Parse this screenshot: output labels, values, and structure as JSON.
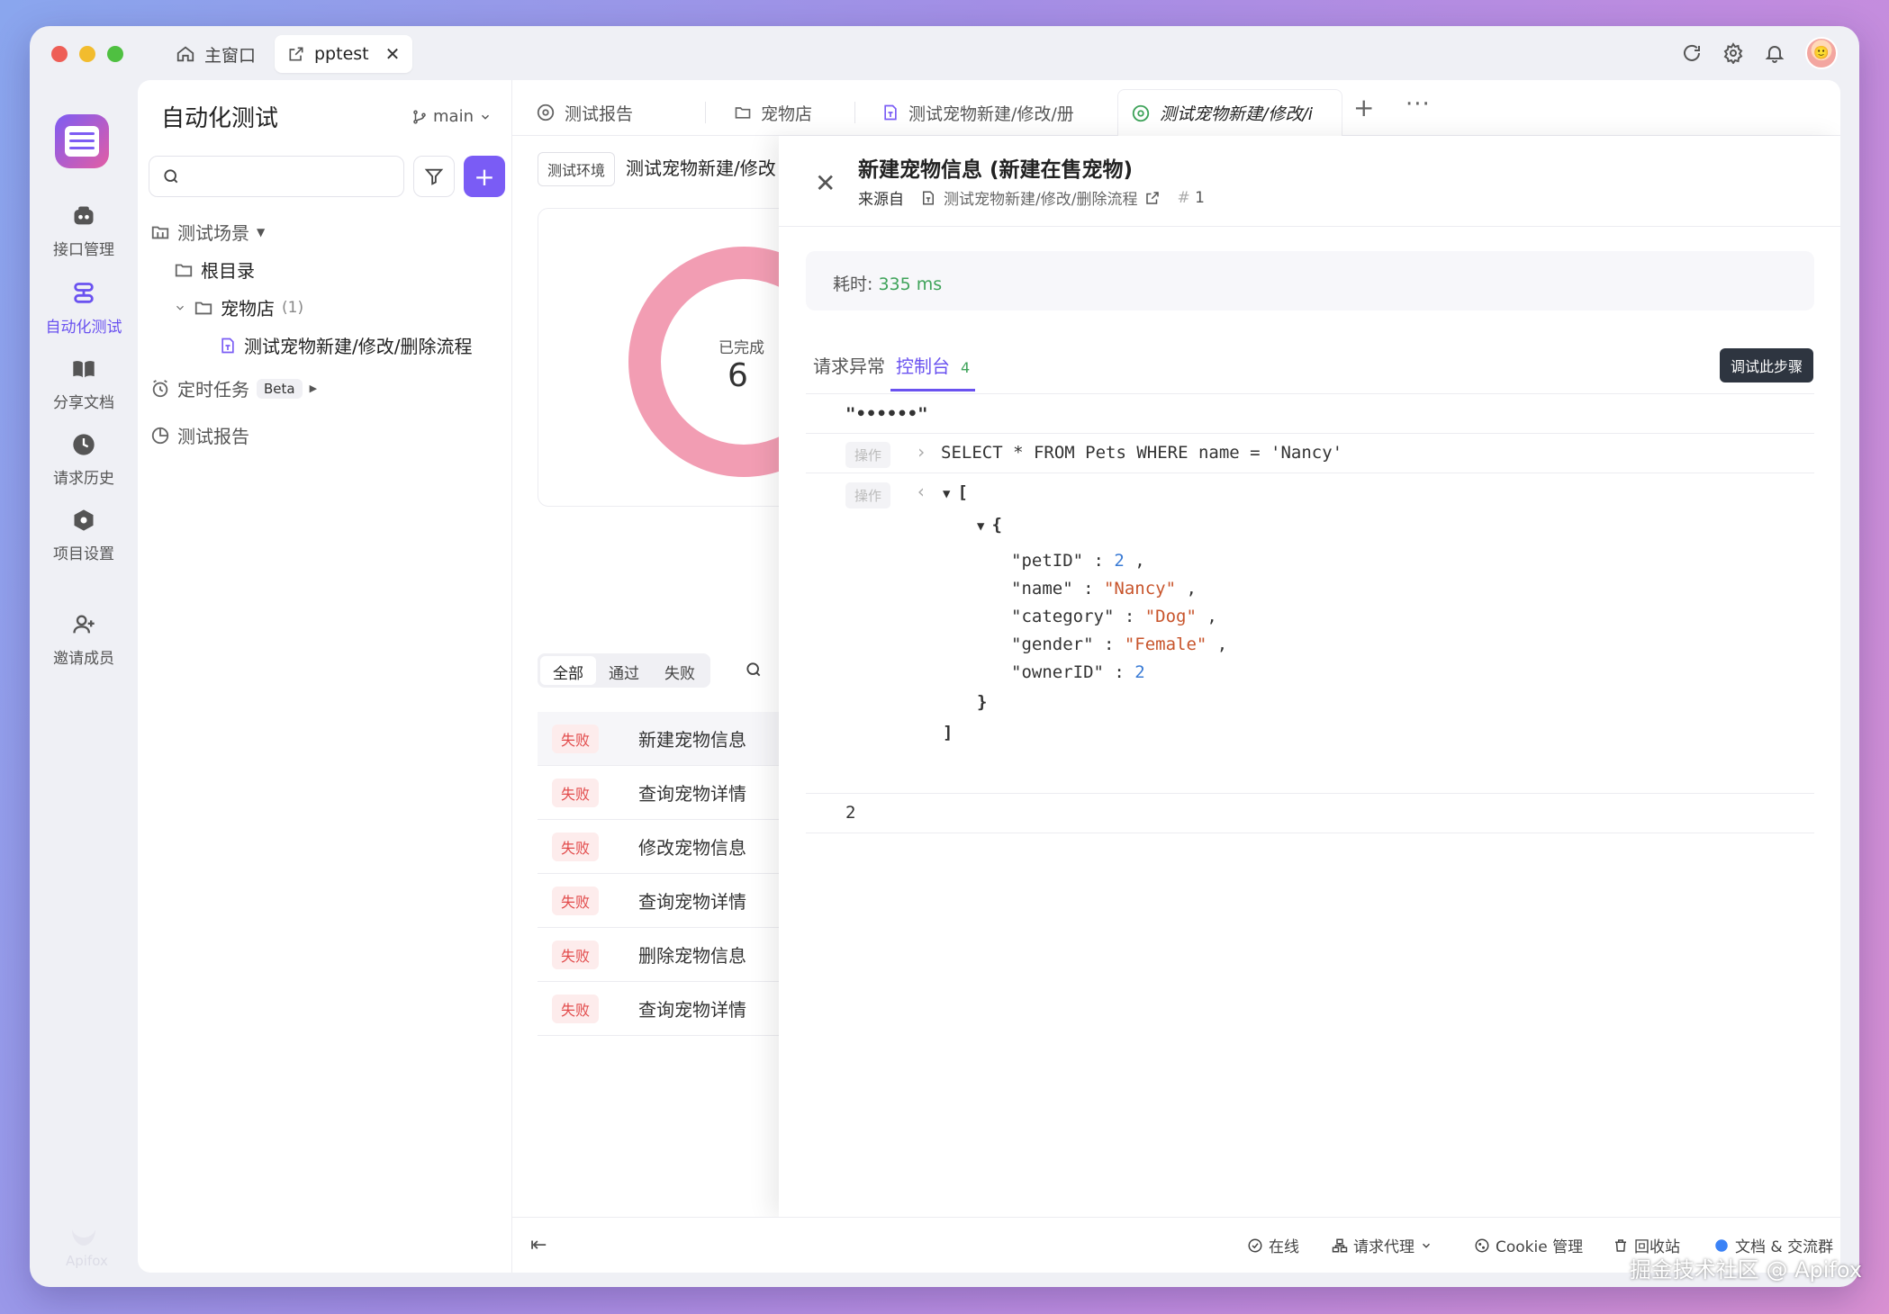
{
  "window": {
    "tabs": [
      {
        "label": "主窗口",
        "icon": "home-icon"
      },
      {
        "label": "pptest",
        "icon": "external-link-icon",
        "close": "✕"
      }
    ]
  },
  "rail": {
    "items": [
      {
        "label": "接口管理",
        "icon": "api-icon"
      },
      {
        "label": "自动化测试",
        "icon": "automation-icon",
        "active": true
      },
      {
        "label": "分享文档",
        "icon": "book-icon"
      },
      {
        "label": "请求历史",
        "icon": "clock-icon"
      },
      {
        "label": "项目设置",
        "icon": "settings-hex-icon"
      },
      {
        "label": "邀请成员",
        "icon": "user-plus-icon"
      }
    ],
    "brand": "Apifox"
  },
  "sidebar": {
    "title": "自动化测试",
    "branch": "main",
    "tree": {
      "scenes": "测试场景",
      "root": "根目录",
      "folder": "宠物店",
      "folder_count": "(1)",
      "scenario": "测试宠物新建/修改/删除流程",
      "scheduled": "定时任务",
      "beta": "Beta",
      "reports": "测试报告"
    }
  },
  "main_tabs": [
    {
      "label": "测试报告",
      "icon": "report-icon"
    },
    {
      "label": "宠物店",
      "icon": "folder-icon"
    },
    {
      "label": "测试宠物新建/修改/册",
      "icon": "ts-file-icon"
    },
    {
      "label": "测试宠物新建/修改/i",
      "icon": "report-icon",
      "active": true
    }
  ],
  "report": {
    "env_label": "测试环境",
    "scenario_name": "测试宠物新建/修改",
    "completed_label": "已完成",
    "completed_count": "6",
    "filters": [
      "全部",
      "通过",
      "失败"
    ],
    "rows": [
      {
        "status": "失败",
        "name": "新建宠物信息"
      },
      {
        "status": "失败",
        "name": "查询宠物详情"
      },
      {
        "status": "失败",
        "name": "修改宠物信息"
      },
      {
        "status": "失败",
        "name": "查询宠物详情"
      },
      {
        "status": "失败",
        "name": "删除宠物信息"
      },
      {
        "status": "失败",
        "name": "查询宠物详情"
      }
    ],
    "donut_color": "#f08ca6"
  },
  "drawer": {
    "close": "✕",
    "title": "新建宠物信息 (新建在售宠物)",
    "source_label": "来源自",
    "source_name": "测试宠物新建/修改/删除流程",
    "hash_prefix": "#",
    "hash_value": "1",
    "timing_label": "耗时:",
    "timing_value": "335 ms",
    "subtabs": {
      "errors": "请求异常",
      "console": "控制台",
      "console_count": "4"
    },
    "debug_button": "调试此步骤",
    "console": {
      "masked": "\"••••••\"",
      "op_label": "操作",
      "sql": "SELECT * FROM Pets WHERE name = 'Nancy'",
      "json": {
        "open_bracket": "[",
        "open_brace": "{",
        "fields": [
          {
            "key": "\"petID\"",
            "value": "2",
            "type": "num"
          },
          {
            "key": "\"name\"",
            "value": "\"Nancy\"",
            "type": "str"
          },
          {
            "key": "\"category\"",
            "value": "\"Dog\"",
            "type": "str"
          },
          {
            "key": "\"gender\"",
            "value": "\"Female\"",
            "type": "str"
          },
          {
            "key": "\"ownerID\"",
            "value": "2",
            "type": "num"
          }
        ],
        "close_brace": "}",
        "close_bracket": "]"
      },
      "result": "2"
    }
  },
  "statusbar": {
    "online": "在线",
    "proxy": "请求代理",
    "cookie": "Cookie 管理",
    "trash": "回收站",
    "docs": "文档 & 交流群"
  },
  "watermark": "掘金技术社区 @ Apifox",
  "colors": {
    "accent": "#6a52f0",
    "success": "#3fa35a",
    "error": "#e24b4b"
  }
}
